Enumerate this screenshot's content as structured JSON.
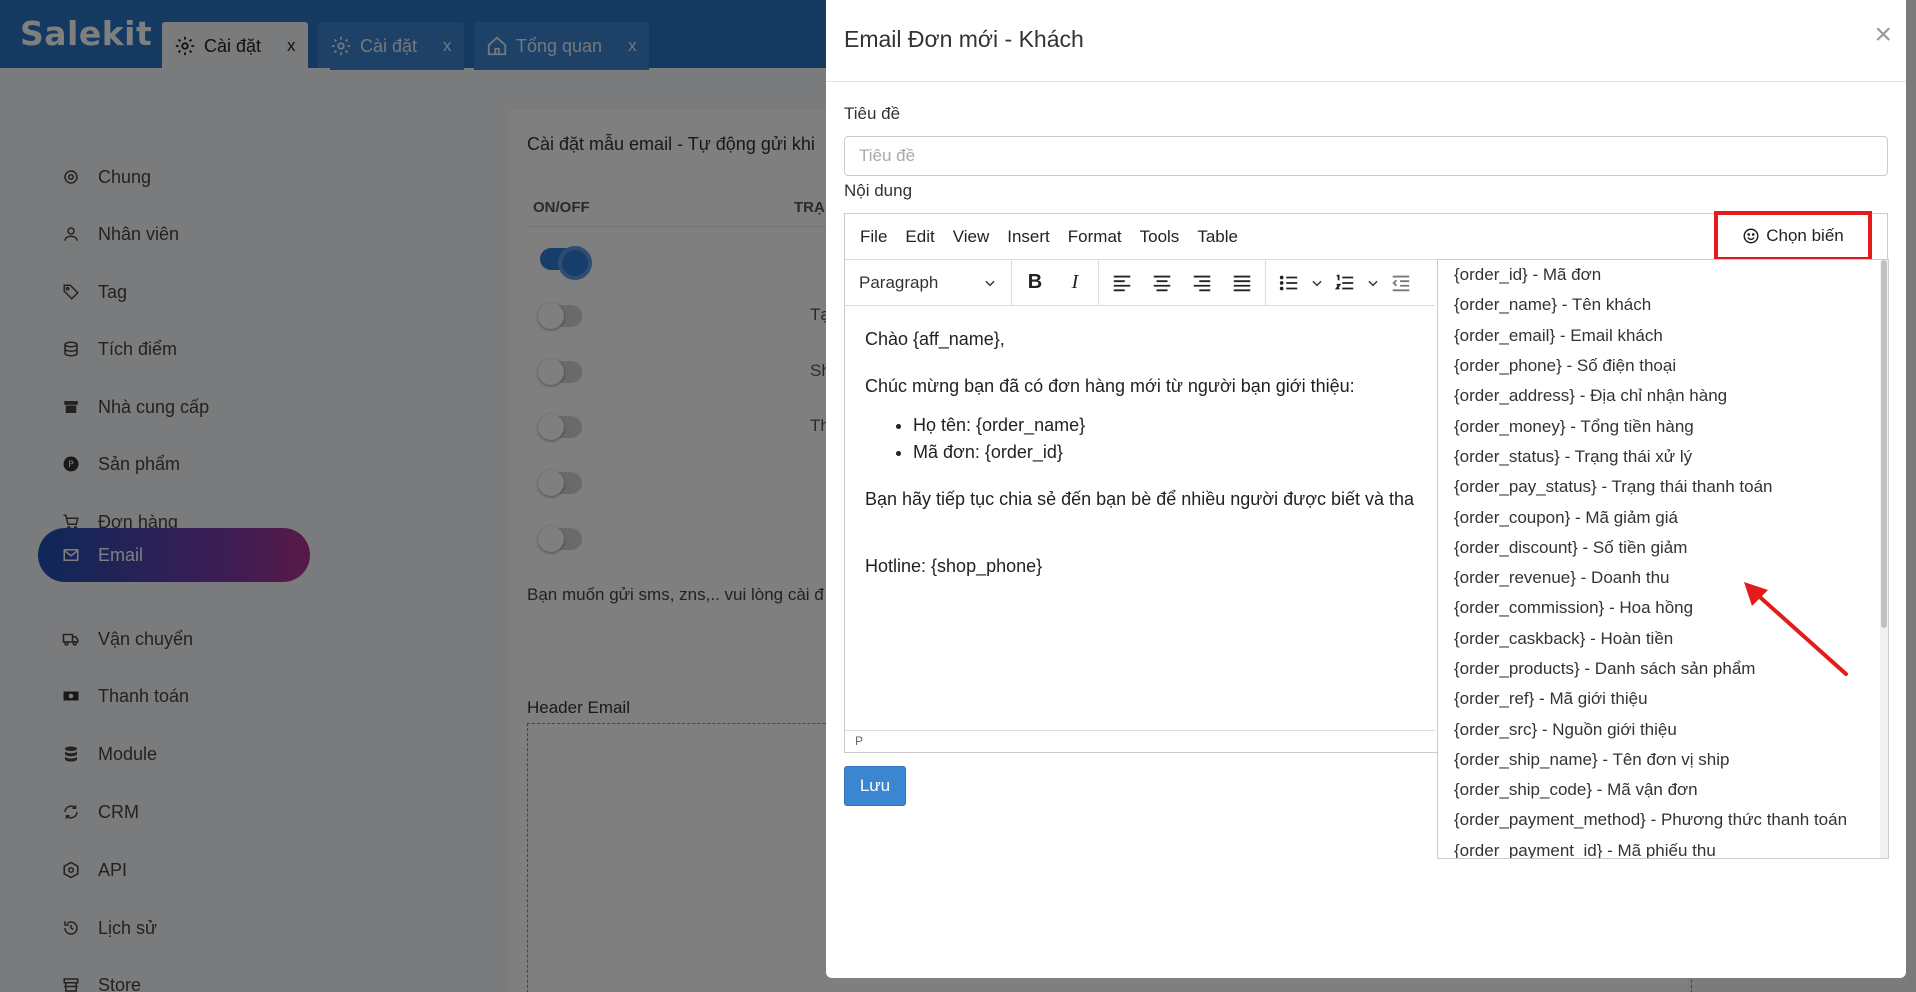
{
  "app": {
    "logo": "Salekit"
  },
  "tabs": [
    {
      "label": "Cài đặt",
      "close": "x",
      "icon": "gear-icon"
    },
    {
      "label": "Cài đặt",
      "close": "x",
      "icon": "gear-icon"
    },
    {
      "label": "Tổng quan",
      "close": "x",
      "icon": "home-icon"
    }
  ],
  "sidebar": {
    "items": [
      {
        "label": "Chung",
        "icon": "gear-icon"
      },
      {
        "label": "Nhân viên",
        "icon": "user-icon"
      },
      {
        "label": "Tag",
        "icon": "tag-icon"
      },
      {
        "label": "Tích điểm",
        "icon": "coins-icon"
      },
      {
        "label": "Nhà cung cấp",
        "icon": "archive-icon"
      },
      {
        "label": "Sản phẩm",
        "icon": "product-icon"
      },
      {
        "label": "Đơn hàng",
        "icon": "cart-icon"
      },
      {
        "label": "Email",
        "icon": "mail-icon",
        "active": true
      },
      {
        "label": "Vận chuyển",
        "icon": "truck-icon"
      },
      {
        "label": "Thanh toán",
        "icon": "money-icon"
      },
      {
        "label": "Module",
        "icon": "database-icon"
      },
      {
        "label": "CRM",
        "icon": "refresh-icon"
      },
      {
        "label": "API",
        "icon": "api-icon"
      },
      {
        "label": "Lịch sử",
        "icon": "history-icon"
      },
      {
        "label": "Store",
        "icon": "store-icon"
      }
    ]
  },
  "main": {
    "title": "Cài đặt mẫu email - Tự động gửi khi",
    "col_onoff": "ON/OFF",
    "col_status": "TRẠ",
    "row_frags": [
      "Tạ",
      "Sh",
      "Th"
    ],
    "note": "Bạn muốn gửi sms, zns,.. vui lòng cài đ",
    "header_email": "Header Email"
  },
  "modal": {
    "title": "Email Đơn mới - Khách",
    "close": "×",
    "title_label": "Tiêu đề",
    "title_placeholder": "Tiêu đề",
    "content_label": "Nội dung",
    "menu": [
      "File",
      "Edit",
      "View",
      "Insert",
      "Format",
      "Tools",
      "Table"
    ],
    "paragraph": "Paragraph",
    "body": {
      "greeting": "Chào {aff_name},",
      "line1": "Chúc mừng bạn đã có đơn hàng mới từ người bạn giới thiệu:",
      "bullets": [
        "Họ tên: {order_name}",
        "Mã đơn: {order_id}"
      ],
      "line2": "Bạn hãy tiếp tục chia sẻ đến bạn bè để nhiều người được biết và tha",
      "hotline": "Hotline: {shop_phone}"
    },
    "status_path": "P",
    "var_button": "Chọn biến",
    "variables": [
      "{order_id} - Mã đơn",
      "{order_name} - Tên khách",
      "{order_email} - Email khách",
      "{order_phone} - Số điện thoại",
      "{order_address} - Địa chỉ nhận hàng",
      "{order_money} - Tổng tiền hàng",
      "{order_status} - Trạng thái xử lý",
      "{order_pay_status} - Trạng thái thanh toán",
      "{order_coupon} - Mã giảm giá",
      "{order_discount} - Số tiền giảm",
      "{order_revenue} - Doanh thu",
      "{order_commission} - Hoa hồng",
      "{order_caskback} - Hoàn tiền",
      "{order_products} - Danh sách sản phẩm",
      "{order_ref} - Mã giới thiệu",
      "{order_src} - Nguồn giới thiệu",
      "{order_ship_name} - Tên đơn vị ship",
      "{order_ship_code} - Mã vận đơn",
      "{order_payment_method} - Phương thức thanh toán",
      "{order_payment_id} - Mã phiếu thu"
    ],
    "save": "Lưu"
  },
  "colors": {
    "accent": "#2a74c4",
    "highlight": "#e41b1b"
  }
}
